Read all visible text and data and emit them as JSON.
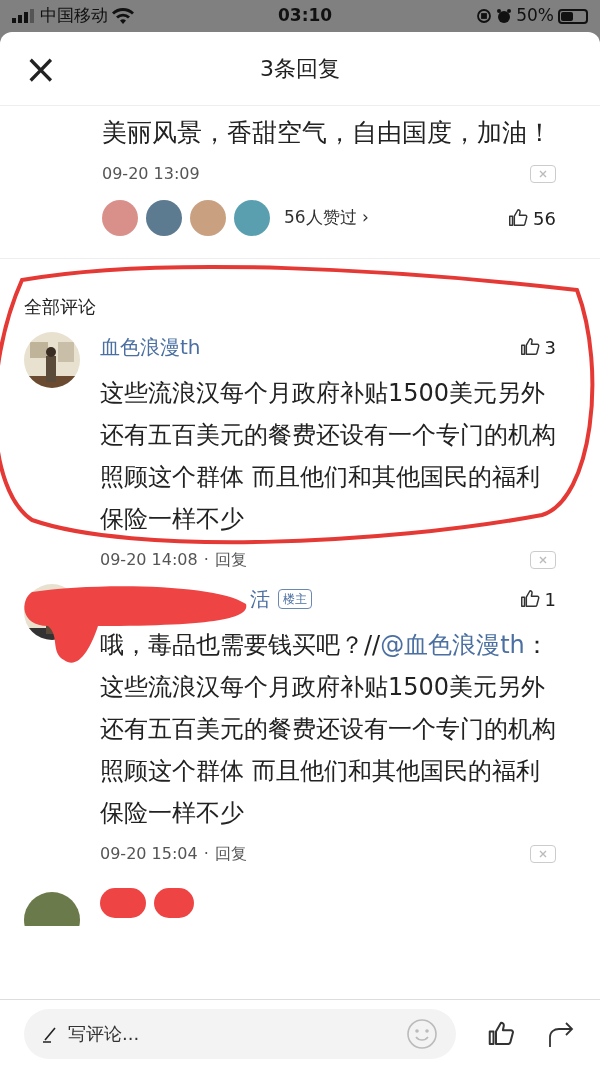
{
  "status_bar": {
    "carrier": "中国移动",
    "time": "03:10",
    "battery": "50%"
  },
  "header": {
    "close": "×",
    "title": "3条回复"
  },
  "main_comment": {
    "text": "美丽风景，香甜空气，自由国度，加油！",
    "time": "09-20 13:09",
    "likers": "56人赞过 ›",
    "likes": "56"
  },
  "section_title": "全部评论",
  "replies": [
    {
      "name": "血色浪漫th",
      "likes": "3",
      "segments": [
        {
          "kind": "text",
          "text": "这些流浪汉每个月政府补贴1500美元另外还有五百美元的餐费还设有一个专门的机构照顾这个群体 而且他们和其他国民的福利保险一样不少"
        }
      ],
      "time": "09-20 14:08",
      "separator": "·",
      "reply": "回复",
      "circled": true,
      "redacted": false
    },
    {
      "name": "活",
      "owner_badge": "楼主",
      "likes": "1",
      "segments": [
        {
          "kind": "text",
          "text": "哦，毒品也需要钱买吧？//"
        },
        {
          "kind": "mention",
          "text": "@血色浪漫th"
        },
        {
          "kind": "text",
          "text": "：这些流浪汉每个月政府补贴1500美元另外还有五百美元的餐费还设有一个专门的机构照顾这个群体 而且他们和其他国民的福利保险一样不少"
        }
      ],
      "time": "09-20 15:04",
      "separator": "·",
      "reply": "回复",
      "circled": false,
      "redacted": true
    }
  ],
  "bottom_bar": {
    "placeholder": "写评论..."
  }
}
